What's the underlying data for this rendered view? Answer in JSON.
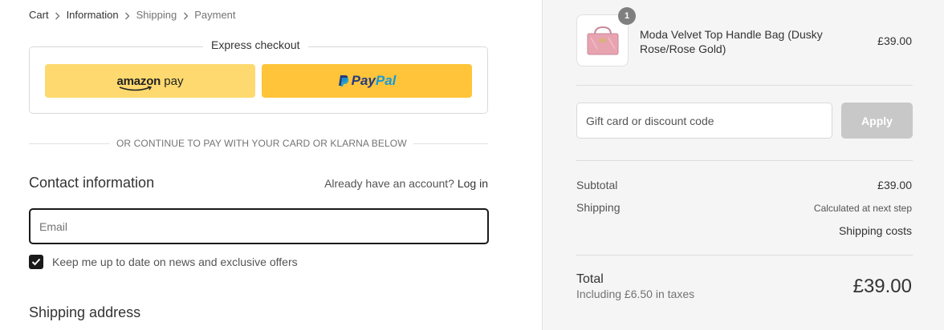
{
  "breadcrumb": {
    "cart": "Cart",
    "information": "Information",
    "shipping": "Shipping",
    "payment": "Payment"
  },
  "express": {
    "title": "Express checkout",
    "amazon_label_a": "amazon",
    "amazon_label_b": " pay",
    "paypal_label_a": "Pay",
    "paypal_label_b": "Pal"
  },
  "divider_text": "OR CONTINUE TO PAY WITH YOUR CARD OR KLARNA BELOW",
  "contact": {
    "heading": "Contact information",
    "account_prompt": "Already have an account?",
    "login_link": "Log in",
    "email_placeholder": "Email",
    "newsletter_label": "Keep me up to date on news and exclusive offers",
    "newsletter_checked": true
  },
  "shipping_heading": "Shipping address",
  "summary": {
    "item": {
      "quantity": "1",
      "name": "Moda Velvet Top Handle Bag (Dusky Rose/Rose Gold)",
      "price": "£39.00",
      "thumb_color": "#e8a3b0"
    },
    "discount_placeholder": "Gift card or discount code",
    "apply_label": "Apply",
    "subtotal_label": "Subtotal",
    "subtotal_value": "£39.00",
    "shipping_label": "Shipping",
    "shipping_value": "Calculated at next step",
    "shipping_costs_link": "Shipping costs",
    "total_label": "Total",
    "tax_line": "Including £6.50 in taxes",
    "total_value": "£39.00"
  },
  "colors": {
    "amazon_button": "#fdd96f",
    "paypal_button": "#ffc439",
    "paypal_dark": "#253b80",
    "paypal_light": "#179bd7",
    "apply_disabled": "#c8c8c8",
    "sidebar_bg": "#f5f5f5"
  }
}
